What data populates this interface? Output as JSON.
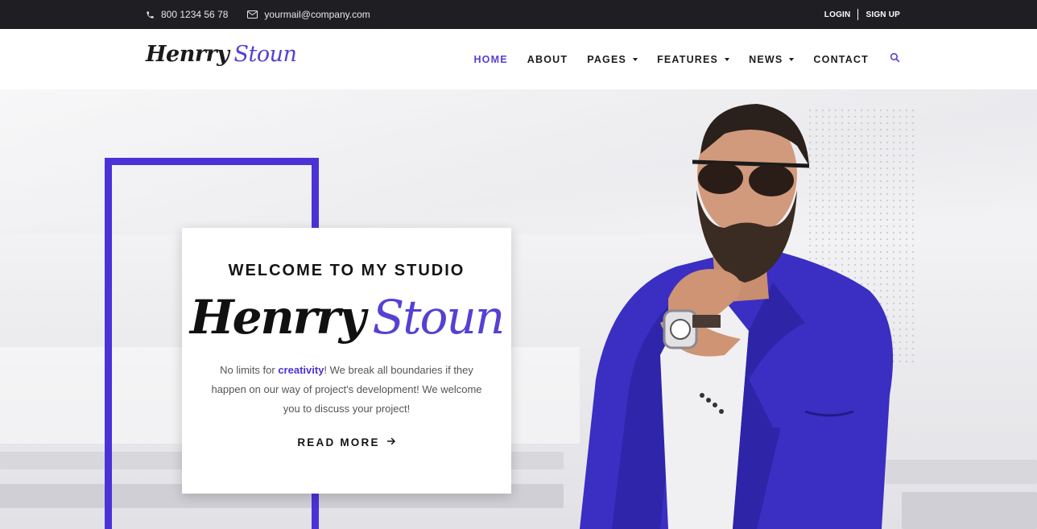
{
  "topbar": {
    "phone": "800 1234 56 78",
    "email": "yourmail@company.com",
    "login": "LOGIN",
    "signup": "SIGN UP"
  },
  "brand": {
    "first": "Henrry",
    "last": "Stoun"
  },
  "nav": {
    "items": [
      {
        "label": "HOME",
        "active": true,
        "dropdown": false
      },
      {
        "label": "ABOUT",
        "active": false,
        "dropdown": false
      },
      {
        "label": "PAGES",
        "active": false,
        "dropdown": true
      },
      {
        "label": "FEATURES",
        "active": false,
        "dropdown": true
      },
      {
        "label": "NEWS",
        "active": false,
        "dropdown": true
      },
      {
        "label": "CONTACT",
        "active": false,
        "dropdown": false
      }
    ],
    "search_icon": "search-icon"
  },
  "hero": {
    "welcome": "WELCOME TO MY STUDIO",
    "name_first": "Henrry",
    "name_last": "Stoun",
    "desc_before": "No limits for ",
    "desc_highlight": "creativity",
    "desc_after": "! We break all boundaries if they happen on our way of project's development! We welcome you to discuss your project!",
    "read_more": "READ MORE"
  },
  "colors": {
    "accent": "#4b32d6",
    "topbar": "#1f1f23",
    "text": "#141414"
  }
}
